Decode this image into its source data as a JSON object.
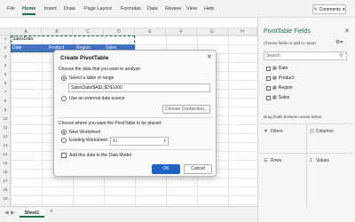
{
  "ribbon": {
    "tabs": [
      "File",
      "Home",
      "Insert",
      "Draw",
      "Page Layout",
      "Formulas",
      "Data",
      "Review",
      "View",
      "Help"
    ],
    "active_tab": "Home",
    "comments_label": "Comments"
  },
  "grid": {
    "column_headers": [
      "A",
      "B",
      "C",
      "D",
      "E",
      "F",
      "G",
      "H"
    ],
    "row_numbers": [
      "1",
      "2",
      "3",
      "4",
      "5",
      "6",
      "7",
      "8",
      "9",
      "10",
      "11",
      "12",
      "13",
      "14",
      "15",
      "16",
      "17",
      "18",
      "19"
    ],
    "a1_value": "SalesData",
    "table_headers": [
      "Date",
      "Product",
      "Region",
      "Sales"
    ]
  },
  "sheets": {
    "tabs": [
      "Sheet1"
    ],
    "add_label": "+"
  },
  "dialog": {
    "title": "Create PivotTable",
    "close_icon": "close-icon",
    "section1_label": "Choose the data that you want to analyze",
    "option_table_label": "Select a table or range",
    "range_value": "SalesData!$A$1:$D$1000",
    "option_external_label": "Use an external data source",
    "choose_connection_label": "Choose Connection...",
    "section2_label": "Choose where you want the PivotTable to be placed",
    "option_new_ws_label": "New Worksheet",
    "option_existing_ws_label": "Existing Worksheet:",
    "existing_ws_value": "$1",
    "data_model_label": "Add this data to the Data Model",
    "ok_label": "OK",
    "cancel_label": "Cancel"
  },
  "panel": {
    "title": "PivotTable Fields",
    "subtitle": "Choose fields to add to report",
    "search_placeholder": "Search",
    "fields": [
      "Date",
      "Product",
      "Region",
      "Sales"
    ],
    "drag_text": "Drag fields between areas below",
    "zones": [
      "Filters",
      "Columns",
      "Rows",
      "Values"
    ]
  },
  "colors": {
    "accent": "#1e7145",
    "table_header": "#4472c4",
    "ok_button": "#1f64c4"
  }
}
